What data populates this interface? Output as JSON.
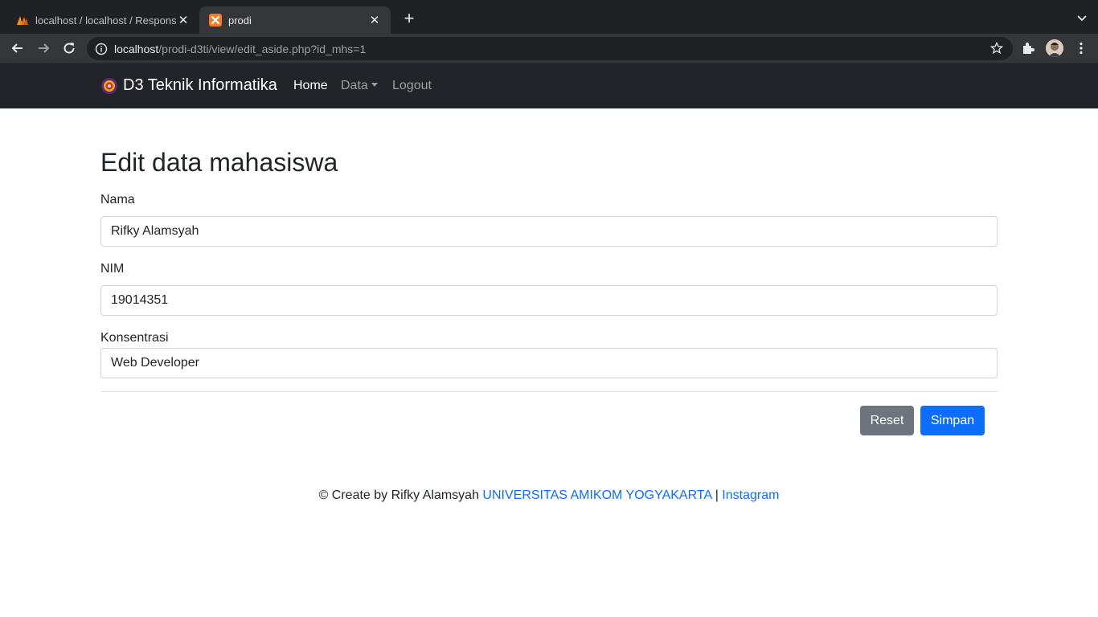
{
  "browser": {
    "tabs": [
      {
        "title": "localhost / localhost / Responsi",
        "active": false
      },
      {
        "title": "prodi",
        "active": true
      }
    ],
    "new_tab_label": "+",
    "url_host": "localhost",
    "url_path": "/prodi-d3ti/view/edit_aside.php?id_mhs=1"
  },
  "navbar": {
    "brand": "D3 Teknik Informatika",
    "links": [
      {
        "label": "Home",
        "active": true
      },
      {
        "label": "Data",
        "dropdown": true
      },
      {
        "label": "Logout"
      }
    ]
  },
  "form": {
    "title": "Edit data mahasiswa",
    "nama_label": "Nama",
    "nama_value": "Rifky Alamsyah",
    "nim_label": "NIM",
    "nim_value": "19014351",
    "konsentrasi_label": "Konsentrasi",
    "konsentrasi_value": "Web Developer",
    "reset_label": "Reset",
    "save_label": "Simpan"
  },
  "footer": {
    "text": "© Create by Rifky Alamsyah",
    "university_link": "UNIVERSITAS AMIKOM YOGYAKARTA",
    "separator": "|",
    "instagram_link": "Instagram"
  },
  "colors": {
    "primary": "#0d6efd",
    "secondary": "#6c757d",
    "navbar_bg": "#212529"
  }
}
